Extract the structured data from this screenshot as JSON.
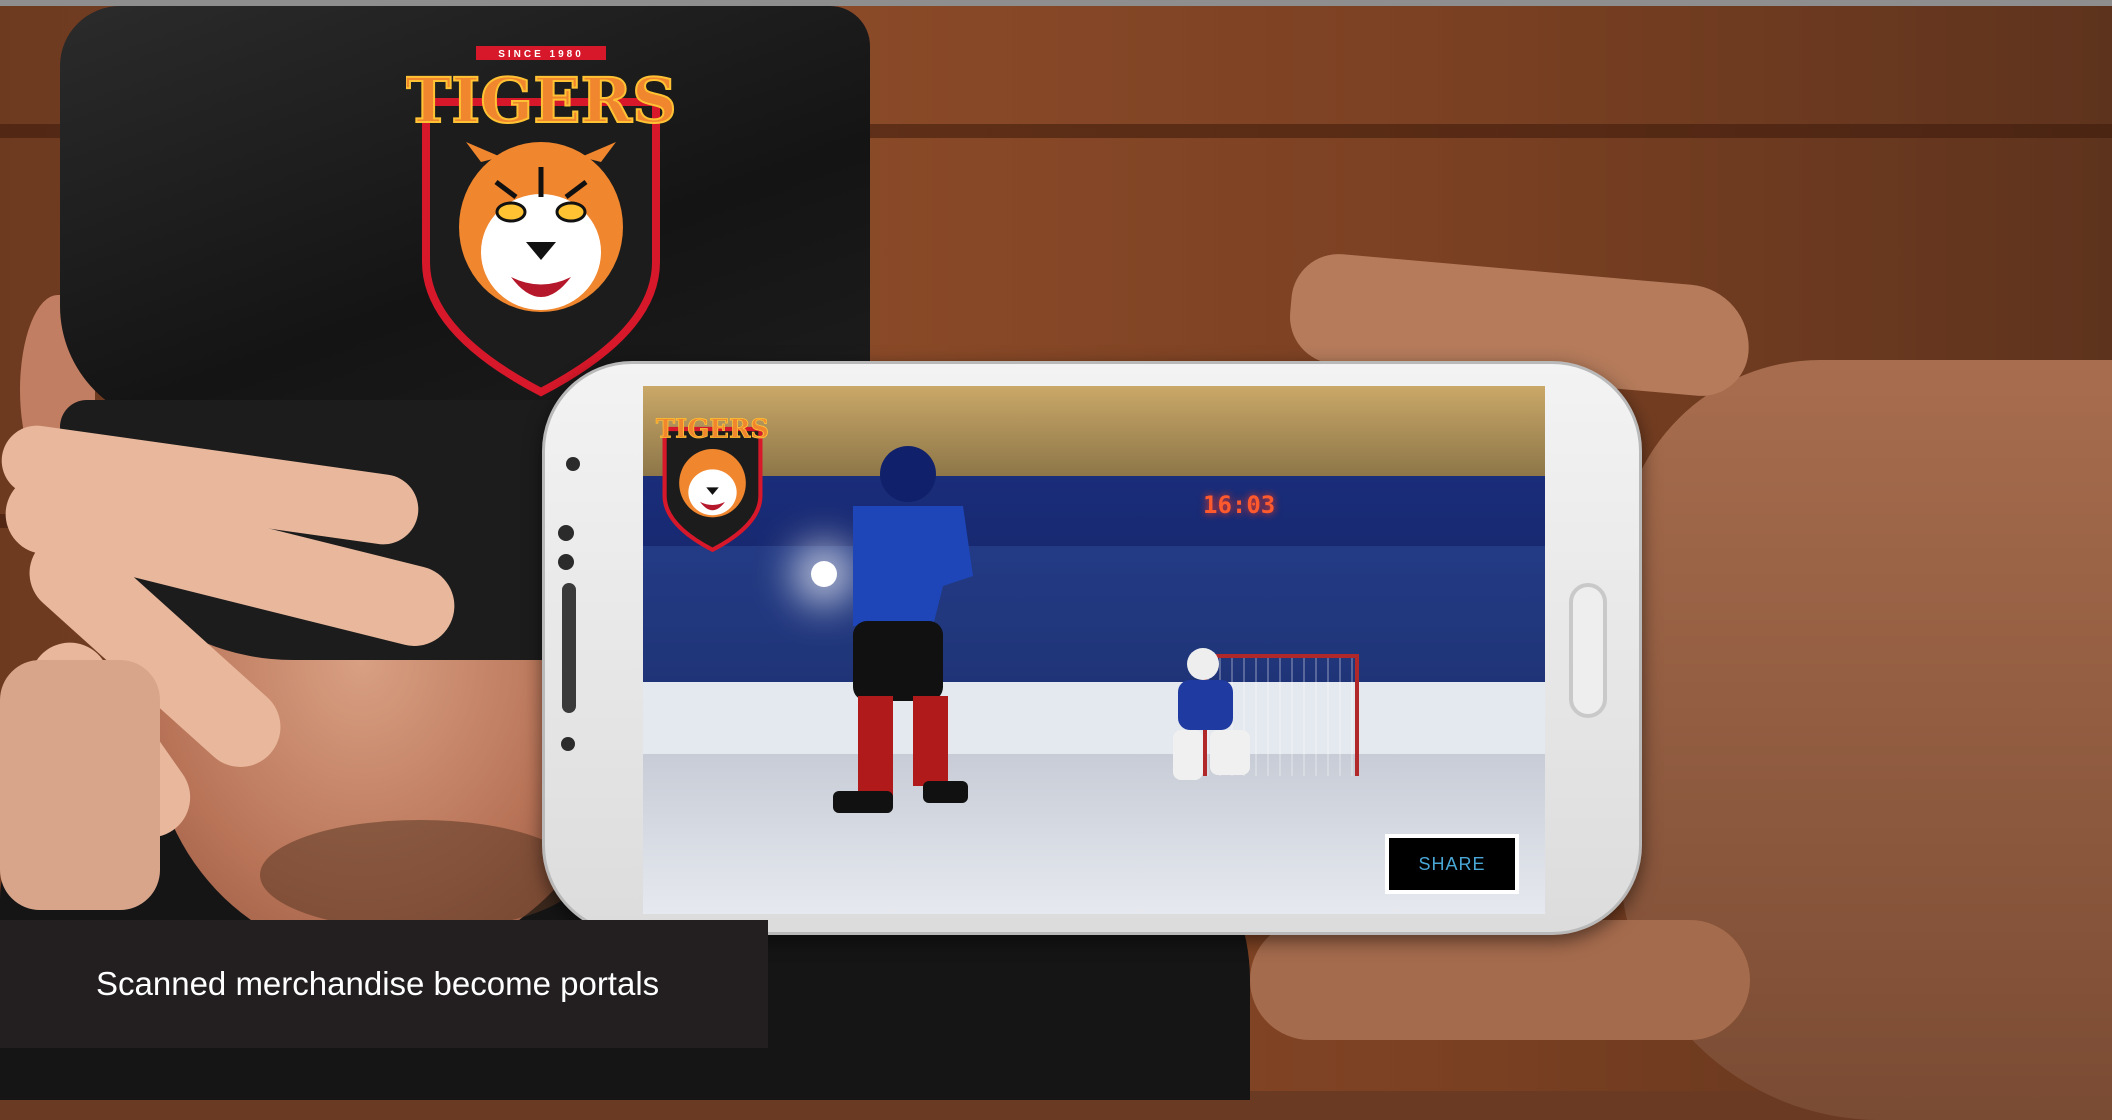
{
  "logo": {
    "brand_text": "TIGERS",
    "since_text": "SINCE 1980",
    "colors": {
      "orange": "#f0862e",
      "yellow": "#ffc233",
      "red": "#d7182a",
      "dark": "#1c1c1c"
    }
  },
  "screen": {
    "scoreboard": "16:03",
    "share_label": "SHARE"
  },
  "caption": {
    "text": "Scanned merchandise become portals"
  }
}
